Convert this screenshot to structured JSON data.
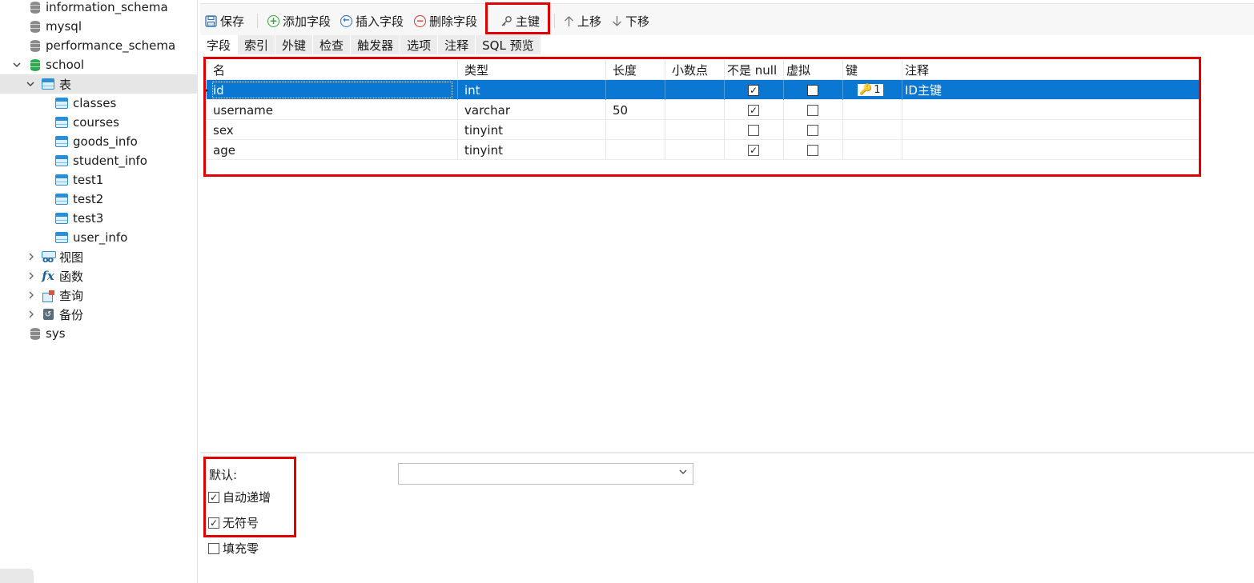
{
  "sidebar": {
    "databases_top": [
      {
        "label": "information_schema"
      },
      {
        "label": "mysql"
      },
      {
        "label": "performance_schema"
      }
    ],
    "school": {
      "label": "school"
    },
    "tables_folder": {
      "label": "表"
    },
    "tables": [
      {
        "label": "classes"
      },
      {
        "label": "courses"
      },
      {
        "label": "goods_info"
      },
      {
        "label": "student_info"
      },
      {
        "label": "test1"
      },
      {
        "label": "test2"
      },
      {
        "label": "test3"
      },
      {
        "label": "user_info"
      }
    ],
    "folders": [
      {
        "label": "视图",
        "icon": "view-icon"
      },
      {
        "label": "函数",
        "icon": "function-icon"
      },
      {
        "label": "查询",
        "icon": "query-icon"
      },
      {
        "label": "备份",
        "icon": "backup-icon"
      }
    ],
    "sys": {
      "label": "sys"
    }
  },
  "toolbar": {
    "save": "保存",
    "add_field": "添加字段",
    "insert_field": "插入字段",
    "delete_field": "删除字段",
    "primary_key": "主键",
    "move_up": "上移",
    "move_down": "下移"
  },
  "tabs": [
    "字段",
    "索引",
    "外键",
    "检查",
    "触发器",
    "选项",
    "注释",
    "SQL 预览"
  ],
  "active_tab": "字段",
  "grid": {
    "headers": {
      "name": "名",
      "type": "类型",
      "length": "长度",
      "decimals": "小数点",
      "not_null": "不是 null",
      "virtual": "虚拟",
      "key": "键",
      "comment": "注释"
    },
    "rows": [
      {
        "name": "id",
        "type": "int",
        "length": "",
        "decimals": "",
        "not_null": true,
        "virtual": false,
        "key": "1",
        "comment": "ID主键",
        "selected": true
      },
      {
        "name": "username",
        "type": "varchar",
        "length": "50",
        "decimals": "",
        "not_null": true,
        "virtual": false,
        "key": "",
        "comment": "",
        "selected": false
      },
      {
        "name": "sex",
        "type": "tinyint",
        "length": "",
        "decimals": "",
        "not_null": false,
        "virtual": false,
        "key": "",
        "comment": "",
        "selected": false
      },
      {
        "name": "age",
        "type": "tinyint",
        "length": "",
        "decimals": "",
        "not_null": true,
        "virtual": false,
        "key": "",
        "comment": "",
        "selected": false
      }
    ]
  },
  "options": {
    "default_label": "默认:",
    "default_value": "",
    "auto_increment": {
      "label": "自动递增",
      "checked": true
    },
    "unsigned": {
      "label": "无符号",
      "checked": true
    },
    "zerofill": {
      "label": "填充零",
      "checked": false
    }
  },
  "colors": {
    "selection": "#0a78d2",
    "highlight_border": "#e00000",
    "add_icon": "#3aa43a",
    "insert_icon": "#1f6fd1",
    "delete_icon": "#d9362b"
  }
}
